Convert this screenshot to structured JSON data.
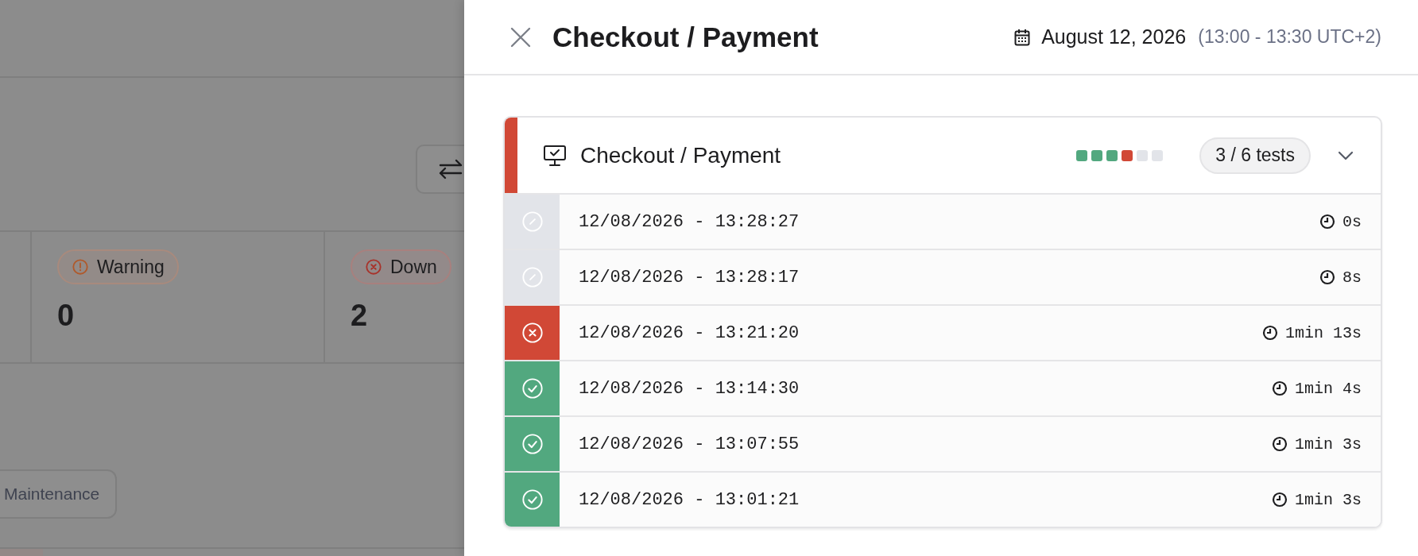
{
  "background": {
    "stats": [
      {
        "kind": "warning",
        "label": "Warning",
        "value": "0"
      },
      {
        "kind": "down",
        "label": "Down",
        "value": "2"
      }
    ],
    "maintenance_button": "Maintenance"
  },
  "panel": {
    "title": "Checkout / Payment",
    "date": "August 12, 2026",
    "time_range": "(13:00 - 13:30 UTC+2)",
    "card": {
      "color": "#d14836",
      "title": "Checkout / Payment",
      "history": [
        {
          "color": "#52a87f"
        },
        {
          "color": "#52a87f"
        },
        {
          "color": "#52a87f"
        },
        {
          "color": "#d14836"
        },
        {
          "color": "#e2e4e9"
        },
        {
          "color": "#e2e4e9"
        }
      ],
      "tests_badge": "3 / 6 tests",
      "expanded": true,
      "runs": [
        {
          "kind": "skipped",
          "timestamp": "12/08/2026 - 13:28:27",
          "duration": "0s"
        },
        {
          "kind": "skipped",
          "timestamp": "12/08/2026 - 13:28:17",
          "duration": "8s"
        },
        {
          "kind": "failed",
          "timestamp": "12/08/2026 - 13:21:20",
          "duration": "1min 13s"
        },
        {
          "kind": "passed",
          "timestamp": "12/08/2026 - 13:14:30",
          "duration": "1min 4s"
        },
        {
          "kind": "passed",
          "timestamp": "12/08/2026 - 13:07:55",
          "duration": "1min 3s"
        },
        {
          "kind": "passed",
          "timestamp": "12/08/2026 - 13:01:21",
          "duration": "1min 3s"
        }
      ]
    }
  }
}
